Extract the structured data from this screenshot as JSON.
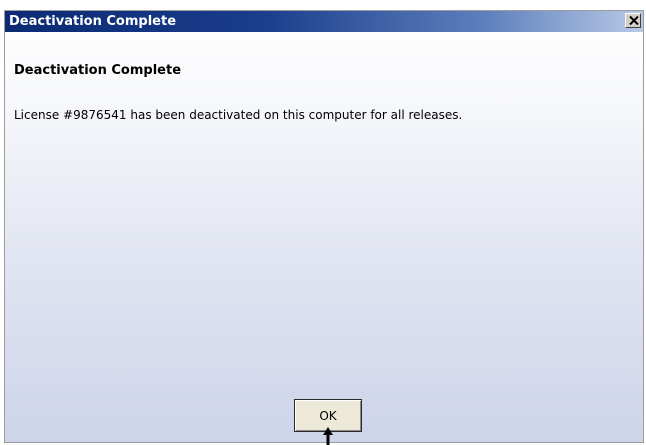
{
  "dialog": {
    "title": "Deactivation Complete",
    "close_label": "X",
    "heading": "Deactivation Complete",
    "message": "License #9876541 has been deactivated on this computer for all releases.",
    "ok_label": "OK"
  },
  "colors": {
    "titlebar_start": "#0b2a73",
    "titlebar_end": "#b9c9e6",
    "body_gradient_bottom": "#cdd3ea"
  },
  "icons": {
    "close": "close-icon",
    "pointer": "mouse-pointer-icon"
  }
}
